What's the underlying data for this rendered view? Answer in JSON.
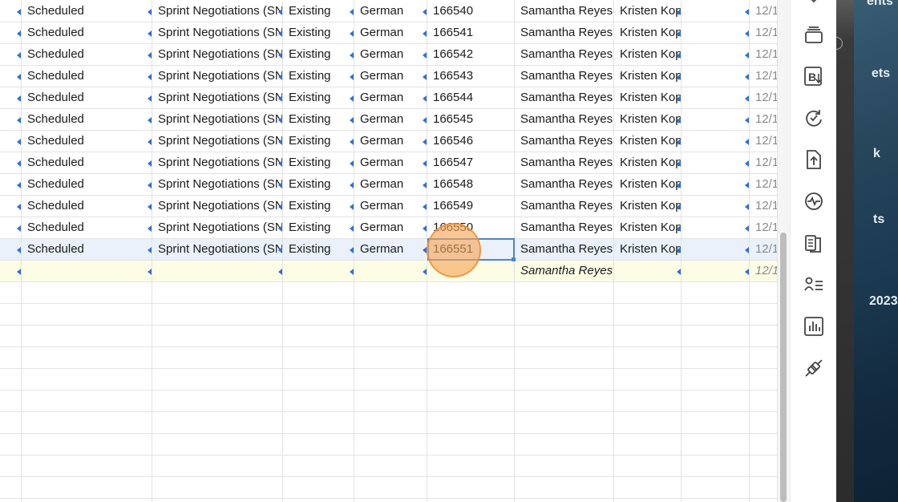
{
  "columns": [
    {
      "key": "status"
    },
    {
      "key": "deal"
    },
    {
      "key": "type"
    },
    {
      "key": "language"
    },
    {
      "key": "id"
    },
    {
      "key": "owner"
    },
    {
      "key": "contact"
    },
    {
      "key": "blank"
    },
    {
      "key": "date"
    }
  ],
  "rows": [
    {
      "status": "Scheduled",
      "deal": "Sprint Negotiations (SN",
      "type": "Existing",
      "language": "German",
      "id": "166540",
      "owner": "Samantha Reyes",
      "contact": "Kristen Kop",
      "blank": "",
      "date": "12/1"
    },
    {
      "status": "Scheduled",
      "deal": "Sprint Negotiations (SN",
      "type": "Existing",
      "language": "German",
      "id": "166541",
      "owner": "Samantha Reyes",
      "contact": "Kristen Kop",
      "blank": "",
      "date": "12/1"
    },
    {
      "status": "Scheduled",
      "deal": "Sprint Negotiations (SN",
      "type": "Existing",
      "language": "German",
      "id": "166542",
      "owner": "Samantha Reyes",
      "contact": "Kristen Kop",
      "blank": "",
      "date": "12/1"
    },
    {
      "status": "Scheduled",
      "deal": "Sprint Negotiations (SN",
      "type": "Existing",
      "language": "German",
      "id": "166543",
      "owner": "Samantha Reyes",
      "contact": "Kristen Kop",
      "blank": "",
      "date": "12/1"
    },
    {
      "status": "Scheduled",
      "deal": "Sprint Negotiations (SN",
      "type": "Existing",
      "language": "German",
      "id": "166544",
      "owner": "Samantha Reyes",
      "contact": "Kristen Kop",
      "blank": "",
      "date": "12/1"
    },
    {
      "status": "Scheduled",
      "deal": "Sprint Negotiations (SN",
      "type": "Existing",
      "language": "German",
      "id": "166545",
      "owner": "Samantha Reyes",
      "contact": "Kristen Kop",
      "blank": "",
      "date": "12/1"
    },
    {
      "status": "Scheduled",
      "deal": "Sprint Negotiations (SN",
      "type": "Existing",
      "language": "German",
      "id": "166546",
      "owner": "Samantha Reyes",
      "contact": "Kristen Kop",
      "blank": "",
      "date": "12/1"
    },
    {
      "status": "Scheduled",
      "deal": "Sprint Negotiations (SN",
      "type": "Existing",
      "language": "German",
      "id": "166547",
      "owner": "Samantha Reyes",
      "contact": "Kristen Kop",
      "blank": "",
      "date": "12/1"
    },
    {
      "status": "Scheduled",
      "deal": "Sprint Negotiations (SN",
      "type": "Existing",
      "language": "German",
      "id": "166548",
      "owner": "Samantha Reyes",
      "contact": "Kristen Kop",
      "blank": "",
      "date": "12/1"
    },
    {
      "status": "Scheduled",
      "deal": "Sprint Negotiations (SN",
      "type": "Existing",
      "language": "German",
      "id": "166549",
      "owner": "Samantha Reyes",
      "contact": "Kristen Kop",
      "blank": "",
      "date": "12/1"
    },
    {
      "status": "Scheduled",
      "deal": "Sprint Negotiations (SN",
      "type": "Existing",
      "language": "German",
      "id": "166550",
      "owner": "Samantha Reyes",
      "contact": "Kristen Kop",
      "blank": "",
      "date": "12/1"
    },
    {
      "status": "Scheduled",
      "deal": "Sprint Negotiations (SN",
      "type": "Existing",
      "language": "German",
      "id": "166551",
      "owner": "Samantha Reyes",
      "contact": "Kristen Kop",
      "blank": "",
      "date": "12/1"
    }
  ],
  "selected_row": 11,
  "focused_column": "id",
  "add_row": {
    "owner": "Samantha Reyes",
    "date": "12/1"
  },
  "sidebar_icons": [
    "card-stack-icon",
    "bold-sort-icon",
    "sync-check-icon",
    "upload-file-icon",
    "activity-icon",
    "document-pages-icon",
    "user-list-icon",
    "bar-chart-icon",
    "plug-connect-icon"
  ],
  "desktop": {
    "labels": [
      "ents",
      "ets",
      "k",
      "ts",
      "2023"
    ]
  },
  "colors": {
    "accent": "#2f6fd6",
    "selected_row": "#eaf1fb",
    "new_row": "#fdfde6",
    "click_marker": "#f7a454"
  }
}
